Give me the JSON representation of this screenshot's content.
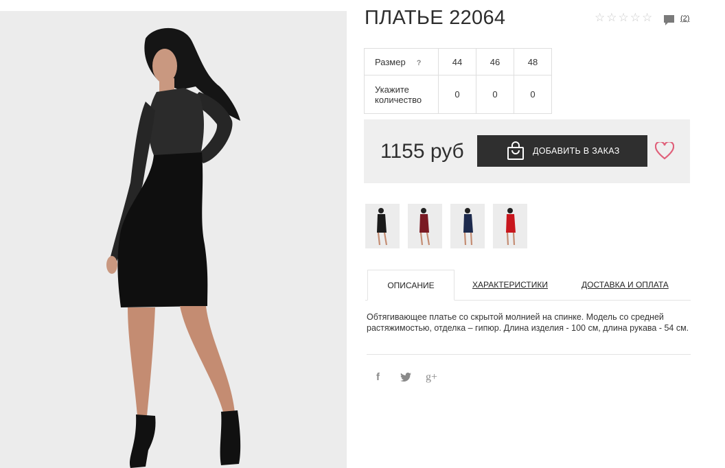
{
  "product": {
    "title": "ПЛАТЬЕ 22064",
    "rating": {
      "stars_total": 5,
      "stars_filled": 0
    },
    "review_count": "(2)"
  },
  "sizes": {
    "size_label": "Размер",
    "help": "?",
    "qty_label": "Укажите количество",
    "values": [
      "44",
      "46",
      "48"
    ],
    "quantities": [
      "0",
      "0",
      "0"
    ]
  },
  "purchase": {
    "price": "1155 руб",
    "add_button": "ДОБАВИТЬ В ЗАКАЗ"
  },
  "thumbnails": [
    {
      "name": "thumb-black",
      "color": "#1a1a1a"
    },
    {
      "name": "thumb-burgundy",
      "color": "#7a1a24"
    },
    {
      "name": "thumb-navy",
      "color": "#1d2a4d"
    },
    {
      "name": "thumb-red",
      "color": "#c8161d"
    }
  ],
  "tabs": [
    "ОПИСАНИЕ",
    "ХАРАКТЕРИСТИКИ",
    "ДОСТАВКА И ОПЛАТА"
  ],
  "description": "Обтягивающее платье со скрытой молнией на спинке. Модель со средней растяжимостью, отделка – гипюр. Длина изделия - 100 см, длина рукава - 54 см.",
  "social": {
    "facebook": "f",
    "twitter": "twitter-icon",
    "googleplus": "g+"
  },
  "colors": {
    "accent_heart": "#e0607a",
    "button_bg": "#2f2f2f",
    "panel_bg": "#efefef"
  }
}
